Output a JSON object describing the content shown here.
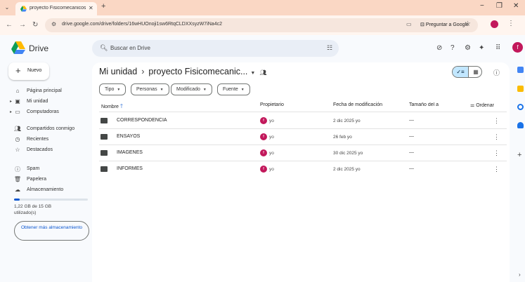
{
  "browser": {
    "tab_title": "proyecto Fisicomecanicos UG",
    "url": "drive.google.com/drive/folders/16wHUOnoji1sw6RtqCLDXXsyzW7iNa4c2",
    "ask_google": "Preguntar a Google"
  },
  "app": {
    "name": "Drive",
    "search_placeholder": "Buscar en Drive",
    "avatar_letter": "f"
  },
  "sidebar": {
    "new_label": "Nuevo",
    "items": [
      {
        "label": "Página principal",
        "icon": "home-icon"
      },
      {
        "label": "Mi unidad",
        "icon": "my-drive-icon"
      },
      {
        "label": "Computadoras",
        "icon": "computer-icon"
      },
      {
        "label": "Compartidos conmigo",
        "icon": "people-icon"
      },
      {
        "label": "Recientes",
        "icon": "clock-icon"
      },
      {
        "label": "Destacados",
        "icon": "star-icon"
      },
      {
        "label": "Spam",
        "icon": "spam-icon"
      },
      {
        "label": "Papelera",
        "icon": "trash-icon"
      },
      {
        "label": "Almacenamiento",
        "icon": "cloud-icon"
      }
    ],
    "storage_used_fraction": 0.08,
    "storage_text": "1,22 GB de 15 GB utilizado(s)",
    "get_more_storage": "Obtener más almacenamiento"
  },
  "main": {
    "breadcrumb_root": "Mi unidad",
    "breadcrumb_current": "proyecto Fisicomecanic...",
    "filters": [
      "Tipo",
      "Personas",
      "Modificado",
      "Fuente"
    ],
    "columns": {
      "name": "Nombre",
      "owner": "Propietario",
      "modified": "Fecha de modificación",
      "size": "Tamaño del a",
      "sort": "Ordenar"
    },
    "rows": [
      {
        "name": "CORRESPONDENCIA",
        "owner_letter": "f",
        "owner": "yo",
        "modified": "2 dic 2025 yo",
        "size": "—"
      },
      {
        "name": "ENSAYOS",
        "owner_letter": "f",
        "owner": "yo",
        "modified": "26 feb yo",
        "size": "—"
      },
      {
        "name": "IMAGENES",
        "owner_letter": "f",
        "owner": "yo",
        "modified": "30 dic 2025 yo",
        "size": "—"
      },
      {
        "name": "INFORMES",
        "owner_letter": "f",
        "owner": "yo",
        "modified": "2 dic 2025 yo",
        "size": "—"
      }
    ]
  },
  "colors": {
    "tabstrip": "#fad7c4",
    "accent": "#0b57d0",
    "avatar": "#c2185b",
    "selected_toggle": "#c2e7ff"
  }
}
